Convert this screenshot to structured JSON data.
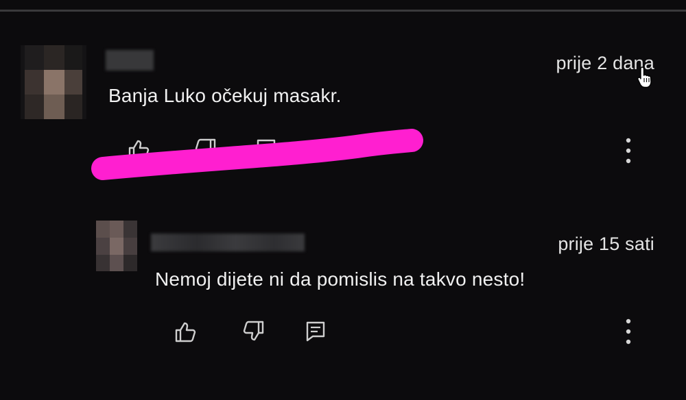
{
  "comments": [
    {
      "text": "Banja Luko očekuj masakr.",
      "timestamp": "prije 2 dana"
    },
    {
      "text": "Nemoj dijete ni da pomislis na takvo nesto!",
      "timestamp": "prije 15 sati"
    }
  ],
  "icons": {
    "like": "thumbs-up-icon",
    "dislike": "thumbs-down-icon",
    "reply": "reply-icon",
    "more": "more-vertical-icon",
    "cursor": "hand-pointer-icon"
  },
  "colors": {
    "background": "#0c0b0d",
    "text": "#f1f1f1",
    "highlight_scribble": "#ff1fd0"
  }
}
